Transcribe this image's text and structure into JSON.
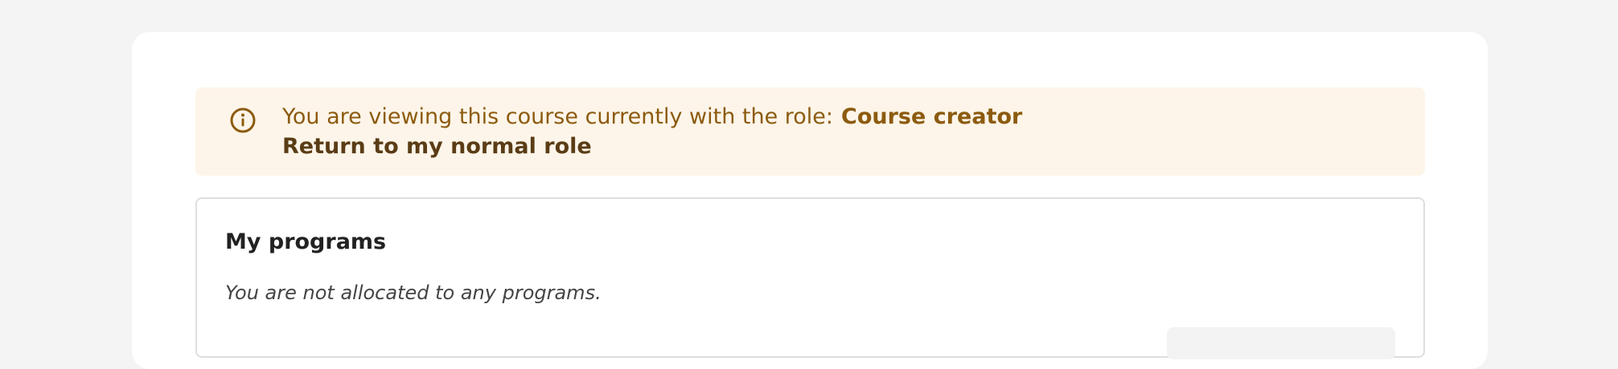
{
  "role_alert": {
    "message": "You are viewing this course currently with the role:",
    "role": "Course creator",
    "return_link": "Return to my normal role",
    "icon": "info-icon",
    "text_color": "#8c5b0f",
    "background_color": "#fdf5e9"
  },
  "programs": {
    "title": "My programs",
    "empty_message": "You are not allocated to any programs."
  }
}
